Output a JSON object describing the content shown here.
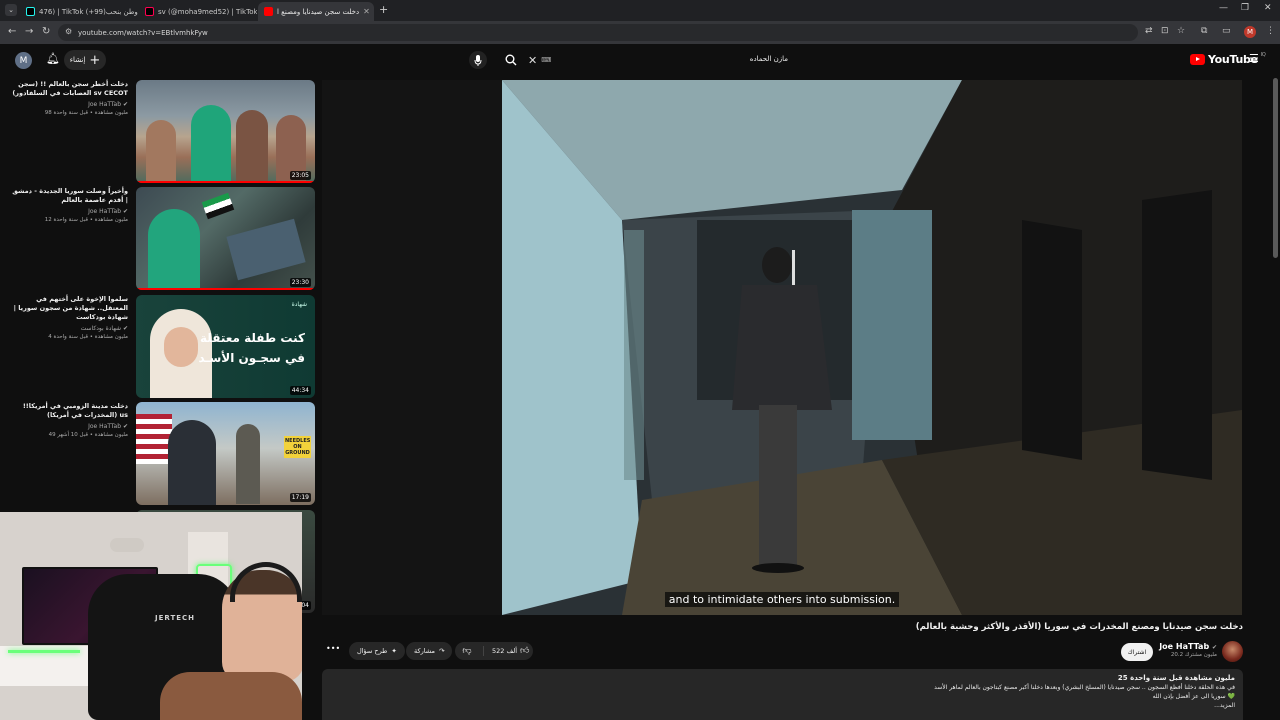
{
  "browser": {
    "tabs": [
      {
        "title": "476) | TikTok (+99)وطن بنحب",
        "color": "#25f4ee"
      },
      {
        "title": "sv (@moha9med52) | TikTok",
        "color": "#ff0050"
      },
      {
        "title": "دخلت سجن صيدنايا ومصنع ا",
        "color": "#ff0000"
      }
    ],
    "new_tab": "+",
    "url": "youtube.com/watch?v=EBtlvmhkFyw",
    "win_min": "—",
    "win_max": "❐",
    "win_close": "✕"
  },
  "youtube": {
    "avatar_letter": "M",
    "create_label": "إنشاء",
    "search_query": "مازن الحماده",
    "keyboard_hint": "⌨",
    "logo": "YouTube",
    "logo_region": "IQ"
  },
  "related": [
    {
      "title": "دخلت أخطر سجن بالعالم !! (سجن العصابات في السلفادور) sv CECOT",
      "channel": "Joe HaTTab",
      "stats": "98 مليون مشاهدة • قبل سنة واحدة",
      "duration": "23:05"
    },
    {
      "title": "وأخيراً وصلت سوريا الجديدة - دمشق | أقدم عاصمة بالعالم",
      "channel": "Joe HaTTab",
      "stats": "12 مليون مشاهدة • قبل سنة واحدة",
      "duration": "23:30"
    },
    {
      "title": "سلموا الإخوة على أختهم في المعتقل.. شهادة من سجون سوريا | شهادة بودكاست",
      "channel": "شهادة بودكاست",
      "stats": "4 مليون مشاهدة • قبل سنة واحدة",
      "duration": "44:34",
      "thumb_text_1": "كنت طفلة معتقلة",
      "thumb_text_2": "في سجـون الأسـد",
      "thumb_brand": "شهادة"
    },
    {
      "title": "دخلت مدينة الزومبي في أمريكا!! (المخدرات في أمريكا) us",
      "channel": "Joe HaTTab",
      "stats": "49 مليون مشاهدة • قبل 10 أشهر",
      "duration": "17:19",
      "thumb_sign": "NEEDLES ON GROUND"
    },
    {
      "duration": "19:04"
    }
  ],
  "webcam": {
    "chair_brand": "JERTECH"
  },
  "video": {
    "caption": "and to intimidate others into submission.",
    "title": "دخلت سجن صيدنايا ومصنع المخدرات في سوريا (الأقذر والأكثر وحشية بالعالم)",
    "channel": "Joe HaTTab",
    "subscribers": "20.2 مليون مشترك",
    "subscribe_label": "اشتراك",
    "likes": "522 ألف",
    "share_label": "مشاركة",
    "ask_label": "طرح سؤال",
    "more_label": "•••",
    "desc_stats": "25 مليون مشاهدة  قبل سنة واحدة",
    "desc_line1": "في هذه الحلقة دخلنا أفظع السجون .. سجن صيدنايا (المسلخ البشري) وبعدها دخلنا أكبر مصنع كبتاجون بالعالم لماهر الأسد",
    "desc_line2": "سوريا الى عز أفضل بإذن الله 💚",
    "desc_more": "...المزيد"
  }
}
